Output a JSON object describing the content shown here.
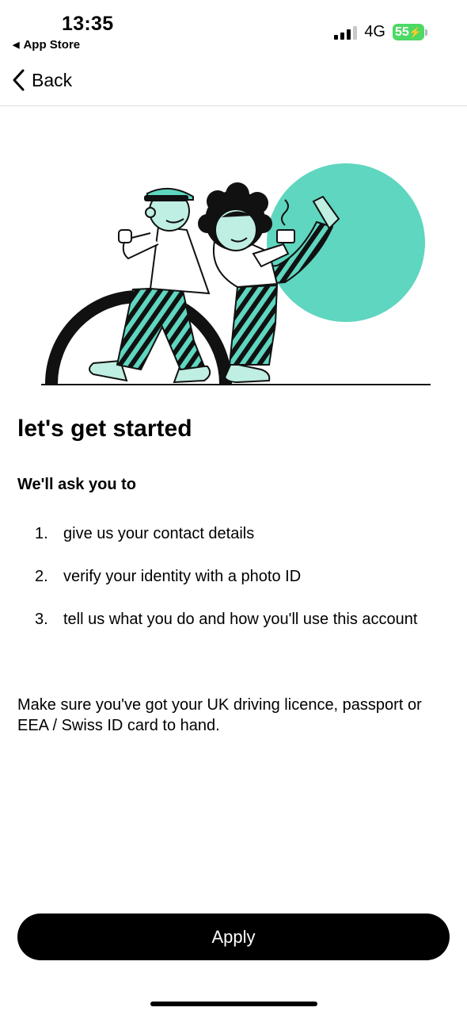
{
  "status_bar": {
    "time": "13:35",
    "back_app": "App Store",
    "network": "4G",
    "battery": "55"
  },
  "nav": {
    "back_label": "Back"
  },
  "content": {
    "title": "let's get started",
    "subtitle": "We'll ask you to",
    "steps": [
      {
        "num": "1.",
        "text": "give us your contact details"
      },
      {
        "num": "2.",
        "text": "verify your identity with a photo ID"
      },
      {
        "num": "3.",
        "text": "tell us what you do and how you'll use this account"
      }
    ],
    "note": "Make sure you've got your UK driving licence, passport or EEA / Swiss ID card to hand."
  },
  "apply_button": "Apply",
  "colors": {
    "accent": "#5fd6bf",
    "primary": "#000000",
    "battery": "#4cd964"
  },
  "icons": {
    "back": "chevron-left-icon",
    "signal": "cellular-signal-icon",
    "battery": "battery-charging-icon"
  }
}
